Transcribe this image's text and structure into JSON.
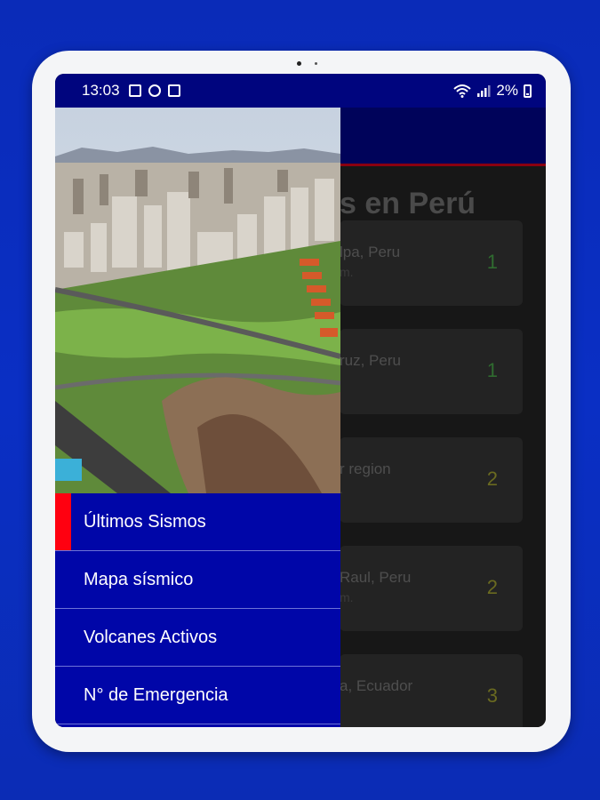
{
  "status_bar": {
    "time": "13:03",
    "battery": "2%"
  },
  "background_content": {
    "title_fragment": "s en Perú",
    "cards": [
      {
        "place": "lpa, Peru",
        "sub": "m.",
        "magnitude": "1",
        "mag_color": "#2f6b2f"
      },
      {
        "place": "ruz, Peru",
        "sub": "",
        "magnitude": "1",
        "mag_color": "#2f6b2f"
      },
      {
        "place": "r region",
        "sub": ".",
        "magnitude": "2",
        "mag_color": "#6a6a20"
      },
      {
        "place": "Raul, Peru",
        "sub": "m.",
        "magnitude": "2",
        "mag_color": "#6a6a20"
      },
      {
        "place": "a, Ecuador",
        "sub": "",
        "magnitude": "3",
        "mag_color": "#6a6a20"
      }
    ]
  },
  "drawer": {
    "menu": [
      {
        "label": "Últimos Sismos",
        "active": true
      },
      {
        "label": "Mapa sísmico",
        "active": false
      },
      {
        "label": "Volcanes Activos",
        "active": false
      },
      {
        "label": "N° de Emergencia",
        "active": false
      }
    ]
  },
  "colors": {
    "accent": "#ff0010",
    "drawer": "#0006a8",
    "status_bar": "#00057e",
    "page_bg": "#0a2fc4"
  }
}
